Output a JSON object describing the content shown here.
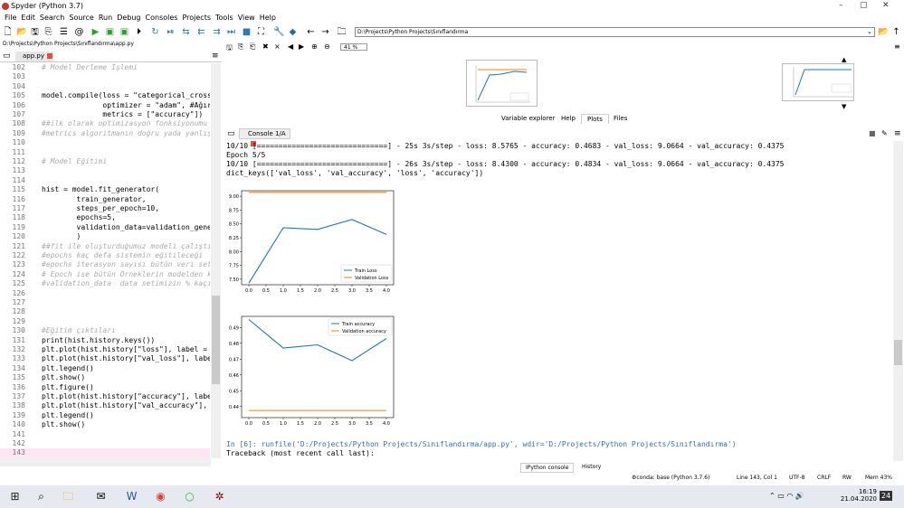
{
  "window": {
    "title": "Spyder (Python 3.7)",
    "min": "–",
    "max": "▢",
    "close": "✕"
  },
  "menu": [
    "File",
    "Edit",
    "Search",
    "Source",
    "Run",
    "Debug",
    "Consoles",
    "Projects",
    "Tools",
    "View",
    "Help"
  ],
  "toolbar": {
    "path": "D:\\Projects\\Python Projects\\Sınıflandırma"
  },
  "editor": {
    "file_path": "D:\\Projects\\Python Projects\\Sınıflandırma\\app.py",
    "tab": "app.py",
    "lines": [
      {
        "n": "102",
        "t": "# Model Derleme İşlemi",
        "c": true
      },
      {
        "n": "103",
        "t": ""
      },
      {
        "n": "104",
        "t": ""
      },
      {
        "n": "105",
        "t": "model.compile(loss = \"categorical_cross"
      },
      {
        "n": "106",
        "t": "              optimizer = \"adam\", #Ağır"
      },
      {
        "n": "107",
        "t": "              metrics = [\"accuracy\"])"
      },
      {
        "n": "108",
        "t": "##ilk olarak optimizasyon fonksiyonumu",
        "c": true
      },
      {
        "n": "109",
        "t": "#metrics algoritmanın doğru yada yanlış",
        "c": true
      },
      {
        "n": "110",
        "t": ""
      },
      {
        "n": "111",
        "t": ""
      },
      {
        "n": "112",
        "t": "# Model Eğitimi",
        "c": true
      },
      {
        "n": "113",
        "t": ""
      },
      {
        "n": "114",
        "t": ""
      },
      {
        "n": "115",
        "t": "hist = model.fit_generator("
      },
      {
        "n": "116",
        "t": "        train_generator,"
      },
      {
        "n": "117",
        "t": "        steps_per_epoch=10,"
      },
      {
        "n": "118",
        "t": "        epochs=5,"
      },
      {
        "n": "119",
        "t": "        validation_data=validation_genera"
      },
      {
        "n": "120",
        "t": "        )"
      },
      {
        "n": "121",
        "t": "##fit ile oluşturduğumuz modeli çalıştı",
        "c": true
      },
      {
        "n": "122",
        "t": "#epochs kaç defa sistemin eğitileceği",
        "c": true
      },
      {
        "n": "123",
        "t": "#epochs iterasyon sayısı bütün veri set",
        "c": true
      },
      {
        "n": "124",
        "t": "# Epoch ise bütün Örneklerin modelden k",
        "c": true
      },
      {
        "n": "125",
        "t": "#validation_data  data setimizin % kaçı",
        "c": true
      },
      {
        "n": "126",
        "t": ""
      },
      {
        "n": "127",
        "t": ""
      },
      {
        "n": "128",
        "t": ""
      },
      {
        "n": "129",
        "t": ""
      },
      {
        "n": "130",
        "t": "#Eğitim çıktıları",
        "c": true
      },
      {
        "n": "131",
        "t": "print(hist.history.keys())"
      },
      {
        "n": "132",
        "t": "plt.plot(hist.history[\"loss\"], label = "
      },
      {
        "n": "133",
        "t": "plt.plot(hist.history[\"val_loss\"], labe"
      },
      {
        "n": "134",
        "t": "plt.legend()"
      },
      {
        "n": "135",
        "t": "plt.show()"
      },
      {
        "n": "136",
        "t": "plt.figure()"
      },
      {
        "n": "137",
        "t": "plt.plot(hist.history[\"accuracy\"], labe"
      },
      {
        "n": "138",
        "t": "plt.plot(hist.history[\"val_accuracy\"],"
      },
      {
        "n": "139",
        "t": "plt.legend()"
      },
      {
        "n": "140",
        "t": "plt.show()"
      },
      {
        "n": "141",
        "t": ""
      },
      {
        "n": "142",
        "t": ""
      },
      {
        "n": "143",
        "t": ""
      }
    ]
  },
  "plots": {
    "zoom": "41 %"
  },
  "pane_tabs": [
    "Variable explorer",
    "Help",
    "Plots",
    "Files"
  ],
  "console": {
    "tab": "Console 1/A",
    "lines_top": [
      "10/10 [==============================] - 25s 3s/step - loss: 8.5765 - accuracy: 0.4683 - val_loss: 9.0664 - val_accuracy: 0.4375",
      "Epoch 5/5",
      "10/10 [==============================] - 26s 3s/step - loss: 8.4300 - accuracy: 0.4834 - val_loss: 9.0664 - val_accuracy: 0.4375",
      "dict_keys(['val_loss', 'val_accuracy', 'loss', 'accuracy'])"
    ],
    "prompt": "In [6]: runfile('D:/Projects/Python Projects/Sınıflandırma/app.py', wdir='D:/Projects/Python Projects/Sınıflandırma')",
    "traceback": "Traceback (most recent call last):"
  },
  "bottom_tabs": [
    "IPython console",
    "History"
  ],
  "status": {
    "conda": "conda: base (Python 3.7.6)",
    "pos": "Line 143, Col 1",
    "enc": "UTF-8",
    "eol": "CRLF",
    "rw": "RW",
    "mem": "Mem 43%"
  },
  "taskbar": {
    "time": "16:19",
    "date": "21.04.2020",
    "notif": "24"
  },
  "chart_data": [
    {
      "type": "line",
      "x": [
        0,
        1,
        2,
        3,
        4
      ],
      "xticks": [
        "0.0",
        "0.5",
        "1.0",
        "1.5",
        "2.0",
        "2.5",
        "3.0",
        "3.5",
        "4.0"
      ],
      "yticks": [
        "7.50",
        "7.75",
        "8.00",
        "8.25",
        "8.50",
        "8.75",
        "9.00"
      ],
      "ylim": [
        7.4,
        9.1
      ],
      "series": [
        {
          "name": "Train Loss",
          "color": "#1f77b4",
          "values": [
            7.43,
            8.43,
            8.4,
            8.58,
            8.31
          ]
        },
        {
          "name": "Validation Loss",
          "color": "#ff7f0e",
          "values": [
            9.07,
            9.07,
            9.07,
            9.07,
            9.07
          ]
        }
      ],
      "legend": "bottom-right"
    },
    {
      "type": "line",
      "x": [
        0,
        1,
        2,
        3,
        4
      ],
      "xticks": [
        "0.0",
        "0.5",
        "1.0",
        "1.5",
        "2.0",
        "2.5",
        "3.0",
        "3.5",
        "4.0"
      ],
      "yticks": [
        "0.44",
        "0.45",
        "0.46",
        "0.47",
        "0.48",
        "0.49"
      ],
      "ylim": [
        0.433,
        0.497
      ],
      "series": [
        {
          "name": "Train accuracy",
          "color": "#1f77b4",
          "values": [
            0.495,
            0.477,
            0.479,
            0.469,
            0.483
          ]
        },
        {
          "name": "Validation accuracy",
          "color": "#ff7f0e",
          "values": [
            0.4375,
            0.4375,
            0.4375,
            0.4375,
            0.4375
          ]
        }
      ],
      "legend": "top-right"
    }
  ]
}
